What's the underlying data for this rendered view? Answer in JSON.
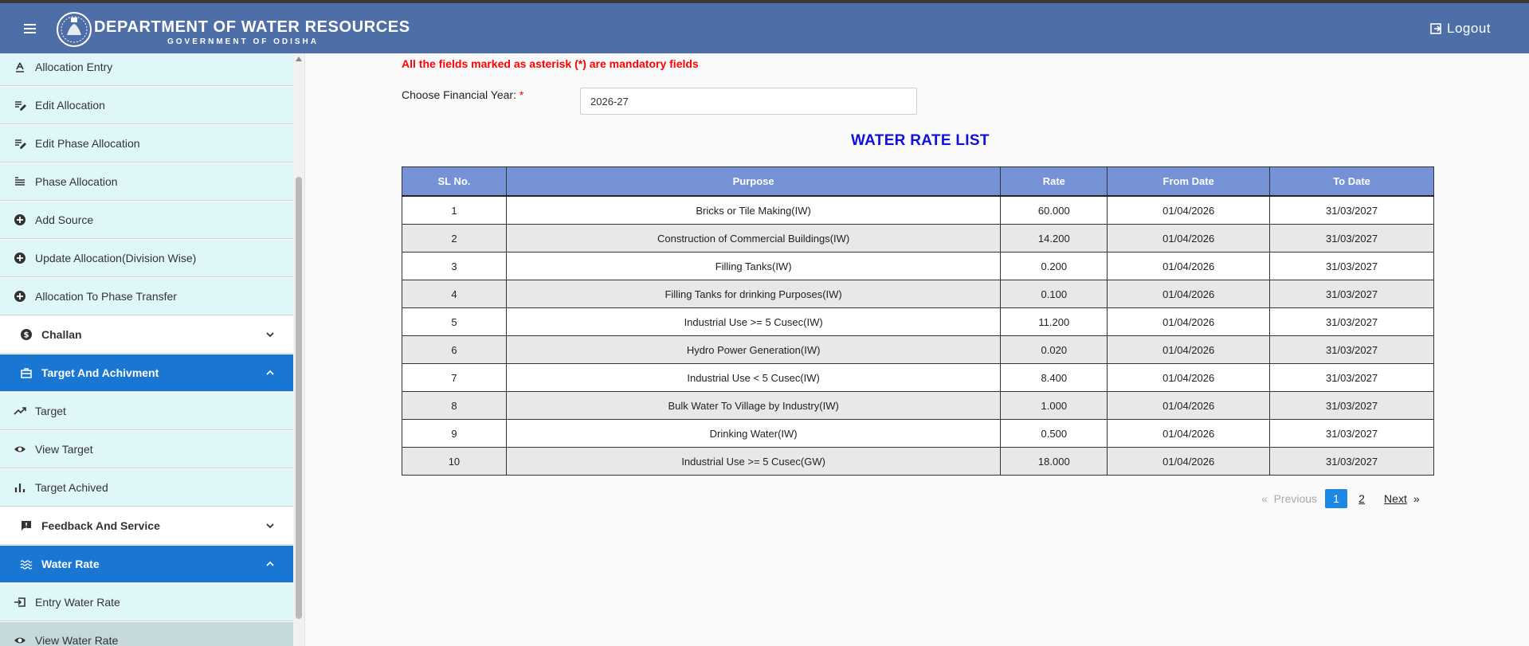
{
  "header": {
    "title": "DEPARTMENT OF WATER RESOURCES",
    "subtitle": "GOVERNMENT OF ODISHA",
    "logout_label": "Logout"
  },
  "sidebar": {
    "items": [
      {
        "label": "Allocation Entry",
        "icon": "text-align-icon"
      },
      {
        "label": "Edit Allocation",
        "icon": "edit-note-icon"
      },
      {
        "label": "Edit Phase Allocation",
        "icon": "edit-note-icon"
      },
      {
        "label": "Phase Allocation",
        "icon": "list-icon"
      },
      {
        "label": "Add Source",
        "icon": "add-circle-icon"
      },
      {
        "label": "Update Allocation(Division Wise)",
        "icon": "add-circle-icon"
      },
      {
        "label": "Allocation To Phase Transfer",
        "icon": "add-circle-icon"
      }
    ],
    "groups": {
      "challan": "Challan",
      "target": "Target And Achivment",
      "feedback": "Feedback And Service",
      "water_rate": "Water Rate"
    },
    "target_items": [
      {
        "label": "Target",
        "icon": "trending-up-icon"
      },
      {
        "label": "View Target",
        "icon": "eye-icon"
      },
      {
        "label": "Target Achived",
        "icon": "bar-chart-icon"
      }
    ],
    "water_rate_items": [
      {
        "label": "Entry Water Rate",
        "icon": "login-icon"
      },
      {
        "label": "View Water Rate",
        "icon": "eye-icon"
      }
    ]
  },
  "main": {
    "mandatory_note": "All the fields marked as asterisk (*) are mandatory fields",
    "fy_label": "Choose Financial Year:",
    "fy_star": "*",
    "fy_value": "2026-27",
    "list_title": "WATER RATE LIST"
  },
  "table": {
    "headers": [
      "SL No.",
      "Purpose",
      "Rate",
      "From Date",
      "To Date"
    ],
    "rows": [
      [
        "1",
        "Bricks or Tile Making(IW)",
        "60.000",
        "01/04/2026",
        "31/03/2027"
      ],
      [
        "2",
        "Construction of Commercial Buildings(IW)",
        "14.200",
        "01/04/2026",
        "31/03/2027"
      ],
      [
        "3",
        "Filling Tanks(IW)",
        "0.200",
        "01/04/2026",
        "31/03/2027"
      ],
      [
        "4",
        "Filling Tanks for drinking Purposes(IW)",
        "0.100",
        "01/04/2026",
        "31/03/2027"
      ],
      [
        "5",
        "Industrial Use >= 5 Cusec(IW)",
        "11.200",
        "01/04/2026",
        "31/03/2027"
      ],
      [
        "6",
        "Hydro Power Generation(IW)",
        "0.020",
        "01/04/2026",
        "31/03/2027"
      ],
      [
        "7",
        "Industrial Use < 5 Cusec(IW)",
        "8.400",
        "01/04/2026",
        "31/03/2027"
      ],
      [
        "8",
        "Bulk Water To Village by Industry(IW)",
        "1.000",
        "01/04/2026",
        "31/03/2027"
      ],
      [
        "9",
        "Drinking Water(IW)",
        "0.500",
        "01/04/2026",
        "31/03/2027"
      ],
      [
        "10",
        "Industrial Use >= 5 Cusec(GW)",
        "18.000",
        "01/04/2026",
        "31/03/2027"
      ]
    ]
  },
  "pagination": {
    "laquo": "«",
    "previous": "Previous",
    "pages": [
      "1",
      "2"
    ],
    "current": "1",
    "next": "Next",
    "raquo": "»"
  }
}
